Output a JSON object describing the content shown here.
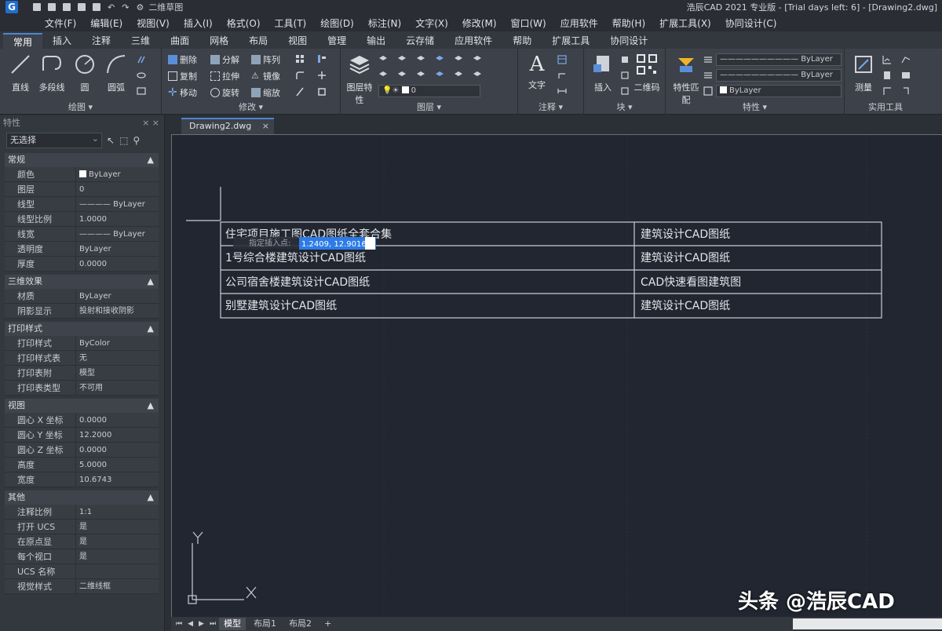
{
  "titlebar": {
    "workspace": "二维草图",
    "title": "浩辰CAD 2021 专业版 - [Trial days left: 6] - [Drawing2.dwg]"
  },
  "menu": [
    "文件(F)",
    "编辑(E)",
    "视图(V)",
    "插入(I)",
    "格式(O)",
    "工具(T)",
    "绘图(D)",
    "标注(N)",
    "文字(X)",
    "修改(M)",
    "窗口(W)",
    "应用软件",
    "帮助(H)",
    "扩展工具(X)",
    "协同设计(C)"
  ],
  "ribbon_tabs": [
    "常用",
    "插入",
    "注释",
    "三维",
    "曲面",
    "网格",
    "布局",
    "视图",
    "管理",
    "输出",
    "云存储",
    "应用软件",
    "帮助",
    "扩展工具",
    "协同设计"
  ],
  "ribbon": {
    "draw": {
      "label": "绘图 ▾",
      "line": "直线",
      "polyline": "多段线",
      "circle": "圆",
      "arc": "圆弧"
    },
    "modify": {
      "label": "修改 ▾",
      "move": "移动",
      "copy": "复制",
      "rotate": "旋转",
      "stretch": "拉伸",
      "delete": "删除",
      "break": "分解",
      "mirror": "镜像",
      "fillet": "圆角",
      "scale": "缩放",
      "array": "阵列",
      "trim": "修剪"
    },
    "layer": {
      "label": "图层 ▾",
      "props": "图层特性",
      "current": "0"
    },
    "annot": {
      "label": "注释 ▾",
      "text": "文字"
    },
    "block": {
      "label": "块 ▾",
      "insert": "插入",
      "qr": "二维码"
    },
    "properties": {
      "label": "特性 ▾",
      "match": "特性匹配",
      "color": "ByLayer",
      "linetype": "ByLayer",
      "lineweight": "ByLayer"
    },
    "utilities": {
      "label": "实用工具",
      "measure": "测量"
    }
  },
  "props_panel": {
    "title": "特性",
    "selection": "无选择",
    "groups": [
      {
        "name": "常规",
        "rows": [
          [
            "颜色",
            "ByLayer"
          ],
          [
            "图层",
            "0"
          ],
          [
            "线型",
            "———— ByLayer"
          ],
          [
            "线型比例",
            "1.0000"
          ],
          [
            "线宽",
            "———— ByLayer"
          ],
          [
            "透明度",
            "ByLayer"
          ],
          [
            "厚度",
            "0.0000"
          ]
        ]
      },
      {
        "name": "三维效果",
        "rows": [
          [
            "材质",
            "ByLayer"
          ],
          [
            "阴影显示",
            "投射和接收阴影"
          ]
        ]
      },
      {
        "name": "打印样式",
        "rows": [
          [
            "打印样式",
            "ByColor"
          ],
          [
            "打印样式表",
            "无"
          ],
          [
            "打印表附",
            "模型"
          ],
          [
            "打印表类型",
            "不可用"
          ]
        ]
      },
      {
        "name": "视图",
        "rows": [
          [
            "圆心 X 坐标",
            "0.0000"
          ],
          [
            "圆心 Y 坐标",
            "12.2000"
          ],
          [
            "圆心 Z 坐标",
            "0.0000"
          ],
          [
            "高度",
            "5.0000"
          ],
          [
            "宽度",
            "10.6743"
          ]
        ]
      },
      {
        "name": "其他",
        "rows": [
          [
            "注释比例",
            "1:1"
          ],
          [
            "打开 UCS",
            "是"
          ],
          [
            "在原点显",
            "是"
          ],
          [
            "每个视口",
            "是"
          ],
          [
            "UCS 名称",
            ""
          ],
          [
            "视觉样式",
            "二维线框"
          ]
        ]
      }
    ]
  },
  "doc_tab": "Drawing2.dwg",
  "table": {
    "rows": [
      [
        "住宅项目施工图CAD图纸全套合集",
        "建筑设计CAD图纸"
      ],
      [
        "1号综合楼建筑设计CAD图纸",
        "建筑设计CAD图纸"
      ],
      [
        "公司宿舍楼建筑设计CAD图纸",
        "CAD快速看图建筑图"
      ],
      [
        "别墅建筑设计CAD图纸",
        "建筑设计CAD图纸"
      ]
    ]
  },
  "input_tooltip": {
    "label": "指定插入点:",
    "value": "1.2409, 12.9016"
  },
  "ucs": {
    "y": "Y",
    "x": "X"
  },
  "layout_tabs": [
    "模型",
    "布局1",
    "布局2",
    "+"
  ],
  "watermark": "头条 @浩辰CAD",
  "colors": {
    "accent": "#4a86d6",
    "canvas": "#212630",
    "highlight": "#1f6fd1"
  }
}
